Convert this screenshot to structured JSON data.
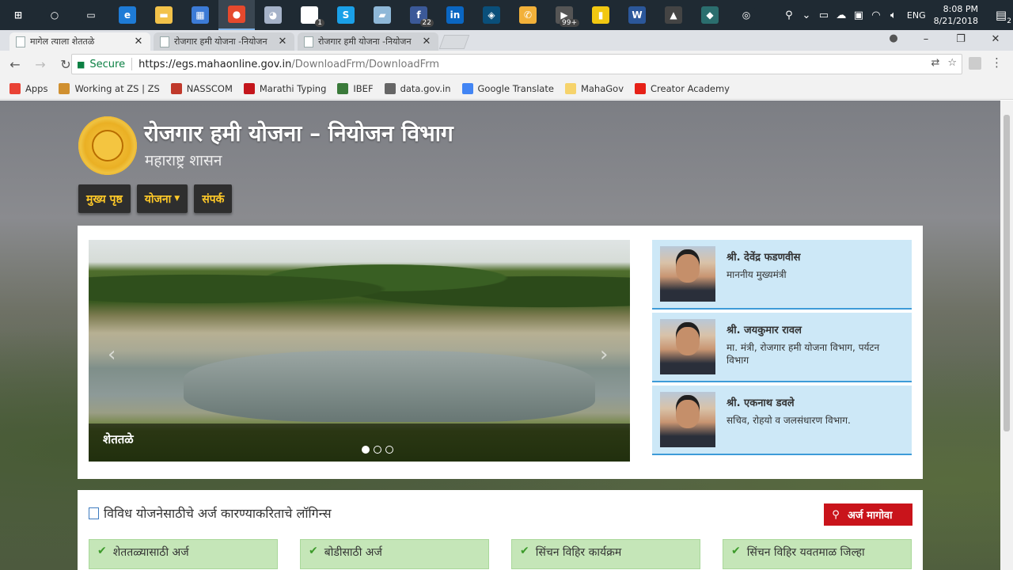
{
  "taskbar": {
    "apps": [
      {
        "name": "windows-start",
        "glyph": "⊞",
        "color": "#1f2a33"
      },
      {
        "name": "cortana",
        "glyph": "○",
        "color": "#1f2a33"
      },
      {
        "name": "task-view",
        "glyph": "▭",
        "color": "#1f2a33"
      },
      {
        "name": "edge",
        "glyph": "e",
        "color": "#1e7bd6"
      },
      {
        "name": "file-explorer",
        "glyph": "▬",
        "color": "#f2c24a"
      },
      {
        "name": "store",
        "glyph": "▦",
        "color": "#3c7bd6"
      },
      {
        "name": "chrome",
        "glyph": "●",
        "color": "#e5492d"
      },
      {
        "name": "paint",
        "glyph": "◕",
        "color": "#a6b3c9"
      },
      {
        "name": "mail",
        "glyph": "✉",
        "color": "#ffffff",
        "badge": "1"
      },
      {
        "name": "skype",
        "glyph": "S",
        "color": "#1aa0e8"
      },
      {
        "name": "notes",
        "glyph": "▰",
        "color": "#8fb8d8"
      },
      {
        "name": "facebook",
        "glyph": "f",
        "color": "#3b5998",
        "badge": "22"
      },
      {
        "name": "linkedin",
        "glyph": "in",
        "color": "#0a66c2"
      },
      {
        "name": "app-blue",
        "glyph": "◈",
        "color": "#0a4f7a"
      },
      {
        "name": "whatsapp",
        "glyph": "✆",
        "color": "#f2b13a"
      },
      {
        "name": "gmail",
        "glyph": "▶",
        "color": "#555555",
        "badge": "99+"
      },
      {
        "name": "powerbi",
        "glyph": "▮",
        "color": "#f2c811"
      },
      {
        "name": "word",
        "glyph": "W",
        "color": "#2b579a"
      },
      {
        "name": "photos",
        "glyph": "▲",
        "color": "#444444"
      },
      {
        "name": "app-green",
        "glyph": "◆",
        "color": "#2b6e6e"
      },
      {
        "name": "app-ring",
        "glyph": "◎",
        "color": "#1f2a33"
      }
    ],
    "lang": "ENG",
    "time": "8:08 PM",
    "date": "8/21/2018",
    "notif_count": "2"
  },
  "tabs": [
    {
      "title": "मागेल त्याला शेततळे",
      "active": true
    },
    {
      "title": "रोजगार हमी योजना -नियोजन",
      "active": false
    },
    {
      "title": "रोजगार हमी योजना -नियोजन",
      "active": false
    }
  ],
  "omnibox": {
    "secure": "Secure",
    "host": "https://egs.mahaonline.gov.in",
    "path": "/DownloadFrm/DownloadFrm"
  },
  "bookmarks": [
    {
      "label": "Apps",
      "color": "#e94235"
    },
    {
      "label": "Working at ZS | ZS",
      "color": "#d09030"
    },
    {
      "label": "NASSCOM",
      "color": "#c0392b"
    },
    {
      "label": "Marathi Typing",
      "color": "#c4161c"
    },
    {
      "label": "IBEF",
      "color": "#3a7a3a"
    },
    {
      "label": "data.gov.in",
      "color": "#666666"
    },
    {
      "label": "Google Translate",
      "color": "#4285f4"
    },
    {
      "label": "MahaGov",
      "color": "#f6d36b"
    },
    {
      "label": "Creator Academy",
      "color": "#e62117"
    }
  ],
  "site": {
    "title": "रोजगार हमी योजना – नियोजन विभाग",
    "subtitle": "महाराष्ट्र शासन",
    "nav": [
      "मुख्य पृष्ठ",
      "योजना",
      "संपर्क"
    ],
    "slide_caption": "शेततळे",
    "people": [
      {
        "name": "श्री. देवेंद्र फडणवीस",
        "role": "माननीय मुख्यमंत्री"
      },
      {
        "name": "श्री. जयकुमार रावल",
        "role": "मा. मंत्री, रोजगार हमी योजना विभाग, पर्यटन विभाग"
      },
      {
        "name": "श्री. एकनाथ डवले",
        "role": "सचिव, रोहयो व जलसंधारण विभाग."
      }
    ],
    "logins_title": "विविध योजनेसाठीचे अर्ज कारण्याकरिताचे लॉगिन्स",
    "request_button": "अर्ज मागोवा",
    "tiles": [
      "शेततळ्यासाठी अर्ज",
      "बोडीसाठी अर्ज",
      "सिंचन विहिर कार्यक्रम",
      "सिंचन विहिर यवतमाळ जिल्हा"
    ]
  }
}
